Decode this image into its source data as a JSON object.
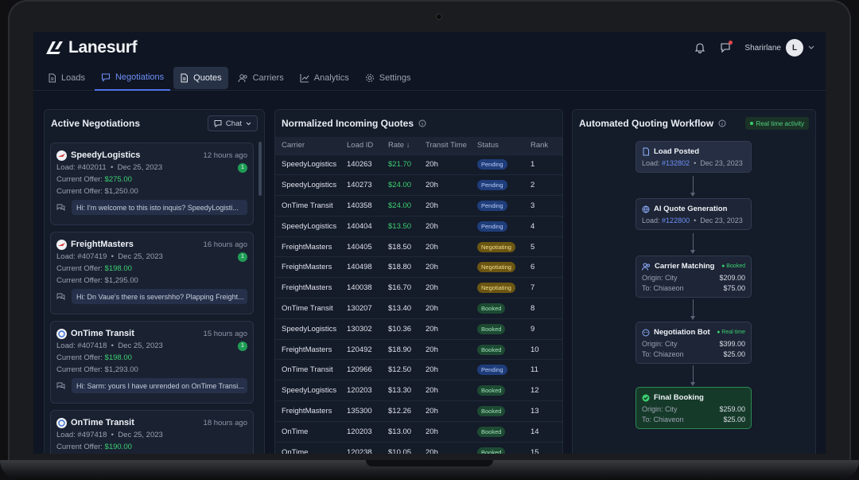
{
  "app": {
    "name": "Lanesurf"
  },
  "user": {
    "name": "Sharirlane",
    "initial": "L"
  },
  "nav": [
    {
      "label": "Loads",
      "icon": "document-icon"
    },
    {
      "label": "Negotiations",
      "icon": "chat-icon"
    },
    {
      "label": "Quotes",
      "icon": "document-icon"
    },
    {
      "label": "Carriers",
      "icon": "users-icon"
    },
    {
      "label": "Analytics",
      "icon": "chart-icon"
    },
    {
      "label": "Settings",
      "icon": "gear-icon"
    }
  ],
  "negotiations": {
    "title": "Active Negotiations",
    "chat_label": "Chat",
    "cards": [
      {
        "carrier": "SpeedyLogistics",
        "time": "12 hours ago",
        "load": "Load: #402011",
        "date": "Dec 25, 2023",
        "current_label": "Current Offer:",
        "offer_green": "$275.00",
        "offer": "Current Offer: $1,250.00",
        "badge": "1",
        "message": "Hi: I'm welcome to this isto inquis? SpeedyLogisti..."
      },
      {
        "carrier": "FreightMasters",
        "time": "16 hours ago",
        "load": "Load: #407419",
        "date": "Dec 25, 2023",
        "current_label": "Current Offer:",
        "offer_green": "$198.00",
        "offer": "Current Offer: $1,295.00",
        "badge": "1",
        "message": "Hi: Dn Vaue's there is severshho? Plapping Freight..."
      },
      {
        "carrier": "OnTime Transit",
        "time": "15 hours ago",
        "load": "Load: #407418",
        "date": "Dec 25, 2023",
        "current_label": "Current Offer:",
        "offer_green": "$198.00",
        "offer": "Current Offer: $1,293.00",
        "badge": "1",
        "message": "Hi: Sarm: yours I have unrended on OnTime Transi..."
      },
      {
        "carrier": "OnTime Transit",
        "time": "18 hours ago",
        "load": "Load: #497418",
        "date": "Dec 25, 2023",
        "current_label": "Current Offer:",
        "offer_green": "$190.00",
        "offer": "",
        "badge": "",
        "message": ""
      }
    ]
  },
  "quotes": {
    "title": "Normalized Incoming Quotes",
    "columns": [
      "Carrier",
      "Load ID",
      "Rate",
      "Transit Time",
      "Status",
      "Rank"
    ],
    "rows": [
      {
        "carrier": "SpeedyLogistics",
        "load_id": "140263",
        "rate": "$21.70",
        "green": true,
        "transit": "20h",
        "status": "Pending",
        "rank": "1"
      },
      {
        "carrier": "SpeedyLogistics",
        "load_id": "140273",
        "rate": "$24.00",
        "green": true,
        "transit": "20h",
        "status": "Pending",
        "rank": "2"
      },
      {
        "carrier": "OnTime Transit",
        "load_id": "140358",
        "rate": "$24.00",
        "green": true,
        "transit": "20h",
        "status": "Pending",
        "rank": "3"
      },
      {
        "carrier": "SpeedyLogistics",
        "load_id": "140404",
        "rate": "$13.50",
        "green": true,
        "transit": "20h",
        "status": "Pending",
        "rank": "4"
      },
      {
        "carrier": "FreightMasters",
        "load_id": "140405",
        "rate": "$18.50",
        "green": false,
        "transit": "20h",
        "status": "Negotiating",
        "rank": "5"
      },
      {
        "carrier": "FreightMasters",
        "load_id": "140498",
        "rate": "$18.80",
        "green": false,
        "transit": "20h",
        "status": "Negotiating",
        "rank": "6"
      },
      {
        "carrier": "FreightMasters",
        "load_id": "140038",
        "rate": "$16.70",
        "green": false,
        "transit": "20h",
        "status": "Negotiating",
        "rank": "7"
      },
      {
        "carrier": "OnTime Transit",
        "load_id": "130207",
        "rate": "$13.40",
        "green": false,
        "transit": "20h",
        "status": "Booked",
        "rank": "8"
      },
      {
        "carrier": "SpeedyLogistics",
        "load_id": "130302",
        "rate": "$10.36",
        "green": false,
        "transit": "20h",
        "status": "Booked",
        "rank": "9"
      },
      {
        "carrier": "FreightMasters",
        "load_id": "120492",
        "rate": "$18.90",
        "green": false,
        "transit": "20h",
        "status": "Booked",
        "rank": "10"
      },
      {
        "carrier": "OnTime Transit",
        "load_id": "120966",
        "rate": "$12.50",
        "green": false,
        "transit": "20h",
        "status": "Pending",
        "rank": "11"
      },
      {
        "carrier": "SpeedyLogistics",
        "load_id": "120203",
        "rate": "$13.30",
        "green": false,
        "transit": "20h",
        "status": "Booked",
        "rank": "12"
      },
      {
        "carrier": "FreightMasters",
        "load_id": "135300",
        "rate": "$12.26",
        "green": false,
        "transit": "20h",
        "status": "Booked",
        "rank": "13"
      },
      {
        "carrier": "OnTime",
        "load_id": "120203",
        "rate": "$13.00",
        "green": false,
        "transit": "20h",
        "status": "Booked",
        "rank": "14"
      },
      {
        "carrier": "OnTime",
        "load_id": "120238",
        "rate": "$10.05",
        "green": false,
        "transit": "20h",
        "status": "Booked",
        "rank": "15"
      }
    ]
  },
  "workflow": {
    "title": "Automated Quoting Workflow",
    "realtime_label": "Real time activity",
    "steps": [
      {
        "title": "Load Posted",
        "icon": "document-icon",
        "tag": "",
        "load_label": "Load:",
        "load_id": "#132802",
        "date": "Dec 23, 2023"
      },
      {
        "title": "AI Quote Generation",
        "icon": "globe-icon",
        "tag": "",
        "load_label": "Load:",
        "load_id": "#122800",
        "date": "Dec 23, 2023"
      },
      {
        "title": "Carrier Matching",
        "icon": "users-icon",
        "tag": "Booked",
        "origin": "Origin: City",
        "origin_val": "$209.00",
        "to": "To: Chiaseon",
        "to_val": "$75.00"
      },
      {
        "title": "Negotiation Bot",
        "icon": "bot-icon",
        "tag": "Real time",
        "origin": "Origin: City",
        "origin_val": "$399.00",
        "to": "To: Chiazeon",
        "to_val": "$25.00"
      },
      {
        "title": "Final Booking",
        "icon": "check-icon",
        "tag": "",
        "origin": "Origin: City",
        "origin_val": "$259.00",
        "to": "To: Chiaveon",
        "to_val": "$25.00"
      }
    ]
  }
}
